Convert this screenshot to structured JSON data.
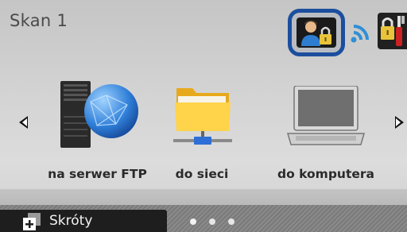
{
  "screen": {
    "title": "Skan 1"
  },
  "status_icons": [
    "secure-function-lock-icon",
    "wifi-icon",
    "settings-lock-icon"
  ],
  "tiles": [
    {
      "label": "na serwer FTP",
      "icon": "ftp-server-icon"
    },
    {
      "label": "do sieci",
      "icon": "network-folder-icon"
    },
    {
      "label": "do komputera",
      "icon": "computer-icon"
    }
  ],
  "footer": {
    "shortcuts_label": "Skróty",
    "pages": 3,
    "active_page": 1
  },
  "colors": {
    "highlight": "#1c4e9e",
    "wifi": "#2f8fd6",
    "bar": "#1e1e1e"
  }
}
